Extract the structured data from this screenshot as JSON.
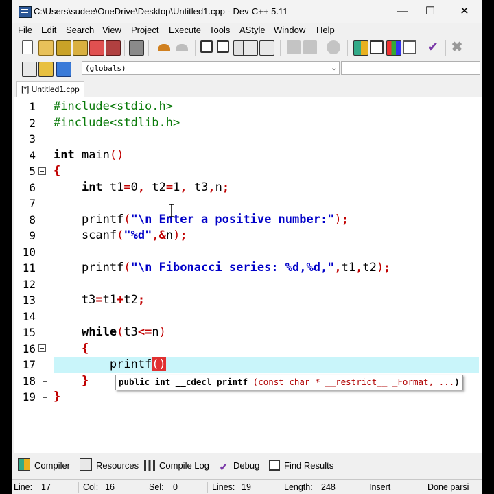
{
  "window": {
    "title": "C:\\Users\\sudee\\OneDrive\\Desktop\\Untitled1.cpp - Dev-C++ 5.11",
    "minimize": "—",
    "maximize": "☐",
    "close": "✕"
  },
  "menu": [
    "File",
    "Edit",
    "Search",
    "View",
    "Project",
    "Execute",
    "Tools",
    "AStyle",
    "Window",
    "Help"
  ],
  "toolbar": {
    "scope_value": "(globals)",
    "scope_arrow": "⌵"
  },
  "editor_tab": "[*] Untitled1.cpp",
  "line_numbers": [
    "1",
    "2",
    "3",
    "4",
    "5",
    "6",
    "7",
    "8",
    "9",
    "10",
    "11",
    "12",
    "13",
    "14",
    "15",
    "16",
    "17",
    "18",
    "19"
  ],
  "code": {
    "l1": "#include<stdio.h>",
    "l2": "#include<stdlib.h>",
    "l4_kw": "int",
    "l4_rest": " main",
    "l4_paren": "()",
    "l5": "{",
    "l6_indent": "    ",
    "l6_kw": "int",
    "l6_a": " t1",
    "l6_eq1": "=",
    "l6_n0": "0",
    "l6_c1": ",",
    "l6_b": " t2",
    "l6_eq2": "=",
    "l6_n1": "1",
    "l6_c2": ",",
    "l6_c": " t3",
    "l6_c3": ",",
    "l6_d": "n",
    "l6_semi": ";",
    "l8_fn": "    printf",
    "l8_p1": "(",
    "l8_str": "\"\\n Enter a positive number:\"",
    "l8_p2": ")",
    "l8_semi": ";",
    "l9_fn": "    scanf",
    "l9_p1": "(",
    "l9_str": "\"%d\"",
    "l9_c": ",",
    "l9_amp": "&",
    "l9_n": "n",
    "l9_p2": ")",
    "l9_semi": ";",
    "l11_fn": "    printf",
    "l11_p1": "(",
    "l11_str": "\"\\n Fibonacci series: %d,%d,\"",
    "l11_c1": ",",
    "l11_a": "t1",
    "l11_c2": ",",
    "l11_b": "t2",
    "l11_p2": ")",
    "l11_semi": ";",
    "l13_a": "    t3",
    "l13_eq": "=",
    "l13_b": "t1",
    "l13_plus": "+",
    "l13_c": "t2",
    "l13_semi": ";",
    "l15_indent": "    ",
    "l15_kw": "while",
    "l15_p1": "(",
    "l15_a": "t3",
    "l15_op": "<=",
    "l15_b": "n",
    "l15_p2": ")",
    "l16": "    {",
    "l17_fn": "        printf",
    "l17_p1": "(",
    "l17_p2": ")",
    "l18": "    }",
    "l19": "}"
  },
  "tooltip": {
    "t1": "public int __cdecl printf ",
    "t2": "(",
    "t3": "const char * __restrict__ _Format",
    "t4": ", ...",
    "t5": ")"
  },
  "bottom_tabs": [
    "Compiler",
    "Resources",
    "Compile Log",
    "Debug",
    "Find Results"
  ],
  "status": {
    "line_label": "Line:",
    "line_val": "17",
    "col_label": "Col:",
    "col_val": "16",
    "sel_label": "Sel:",
    "sel_val": "0",
    "lines_label": "Lines:",
    "lines_val": "19",
    "length_label": "Length:",
    "length_val": "248",
    "mode": "Insert",
    "parse": "Done parsi"
  },
  "colors": {
    "preprocessor": "#0a7a0a",
    "string": "#0000c8",
    "symbol": "#c00000",
    "current_line": "#c9f5fa"
  }
}
